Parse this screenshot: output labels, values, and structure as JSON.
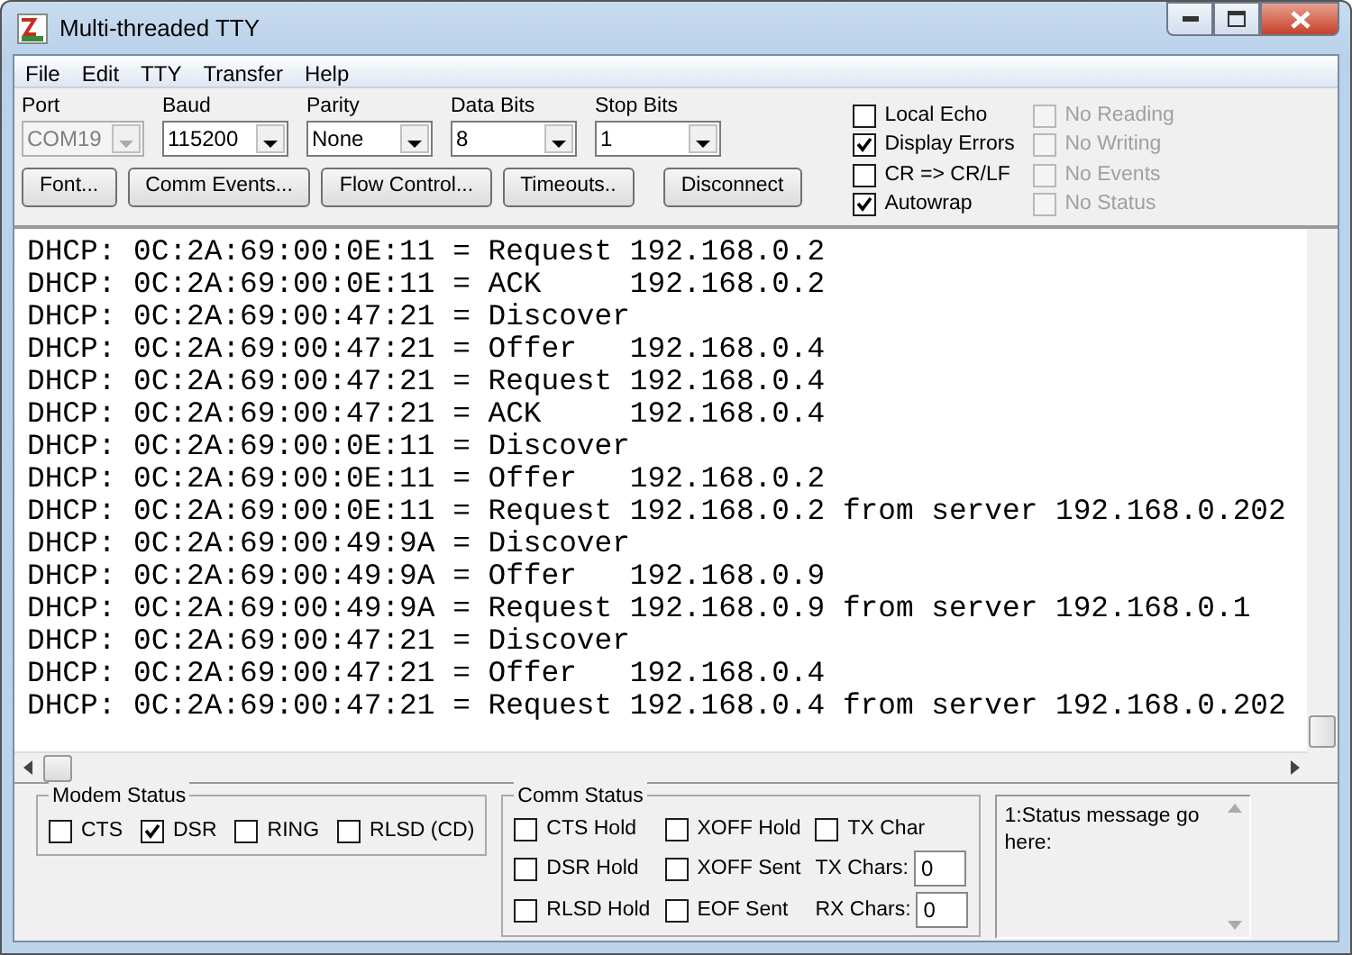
{
  "window": {
    "title": "Multi-threaded TTY"
  },
  "menu": [
    "File",
    "Edit",
    "TTY",
    "Transfer",
    "Help"
  ],
  "settings": [
    {
      "label": "Port",
      "value": "COM19",
      "disabled": true
    },
    {
      "label": "Baud",
      "value": "115200",
      "disabled": false
    },
    {
      "label": "Parity",
      "value": "None",
      "disabled": false
    },
    {
      "label": "Data Bits",
      "value": "8",
      "disabled": false
    },
    {
      "label": "Stop Bits",
      "value": "1",
      "disabled": false
    }
  ],
  "buttons": [
    "Font...",
    "Comm Events...",
    "Flow Control...",
    "Timeouts..",
    "Disconnect"
  ],
  "options": [
    {
      "label": "Local Echo",
      "checked": false,
      "disabled": false
    },
    {
      "label": "Display Errors",
      "checked": true,
      "disabled": false
    },
    {
      "label": "CR => CR/LF",
      "checked": false,
      "disabled": false
    },
    {
      "label": "Autowrap",
      "checked": true,
      "disabled": false
    },
    {
      "label": "No Reading",
      "checked": false,
      "disabled": true
    },
    {
      "label": "No Writing",
      "checked": false,
      "disabled": true
    },
    {
      "label": "No Events",
      "checked": false,
      "disabled": true
    },
    {
      "label": "No Status",
      "checked": false,
      "disabled": true
    }
  ],
  "terminal": {
    "lines": [
      "DHCP: 0C:2A:69:00:0E:11 = Request 192.168.0.2",
      "DHCP: 0C:2A:69:00:0E:11 = ACK     192.168.0.2",
      "DHCP: 0C:2A:69:00:47:21 = Discover",
      "DHCP: 0C:2A:69:00:47:21 = Offer   192.168.0.4",
      "DHCP: 0C:2A:69:00:47:21 = Request 192.168.0.4",
      "DHCP: 0C:2A:69:00:47:21 = ACK     192.168.0.4",
      "DHCP: 0C:2A:69:00:0E:11 = Discover",
      "DHCP: 0C:2A:69:00:0E:11 = Offer   192.168.0.2",
      "DHCP: 0C:2A:69:00:0E:11 = Request 192.168.0.2 from server 192.168.0.202",
      "DHCP: 0C:2A:69:00:49:9A = Discover",
      "DHCP: 0C:2A:69:00:49:9A = Offer   192.168.0.9",
      "DHCP: 0C:2A:69:00:49:9A = Request 192.168.0.9 from server 192.168.0.1",
      "DHCP: 0C:2A:69:00:47:21 = Discover",
      "DHCP: 0C:2A:69:00:47:21 = Offer   192.168.0.4",
      "DHCP: 0C:2A:69:00:47:21 = Request 192.168.0.4 from server 192.168.0.202"
    ]
  },
  "modem_status": {
    "title": "Modem Status",
    "items": [
      {
        "label": "CTS",
        "checked": false
      },
      {
        "label": "DSR",
        "checked": true
      },
      {
        "label": "RING",
        "checked": false
      },
      {
        "label": "RLSD (CD)",
        "checked": false
      }
    ]
  },
  "comm_status": {
    "title": "Comm Status",
    "items": [
      {
        "kind": "check",
        "label": "CTS Hold",
        "checked": false
      },
      {
        "kind": "check",
        "label": "XOFF Hold",
        "checked": false
      },
      {
        "kind": "check",
        "label": "TX Char",
        "checked": false
      },
      {
        "kind": "check",
        "label": "DSR Hold",
        "checked": false
      },
      {
        "kind": "check",
        "label": "XOFF Sent",
        "checked": false
      },
      {
        "kind": "counter",
        "label": "TX Chars:",
        "value": "0"
      },
      {
        "kind": "check",
        "label": "RLSD Hold",
        "checked": false
      },
      {
        "kind": "check",
        "label": "EOF Sent",
        "checked": false
      },
      {
        "kind": "counter",
        "label": "RX Chars:",
        "value": "0"
      }
    ]
  },
  "status_message": "1:Status message go here:"
}
